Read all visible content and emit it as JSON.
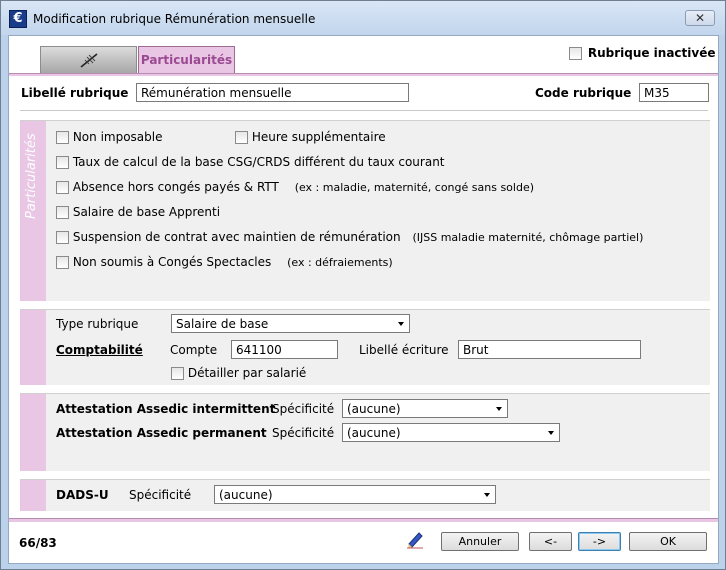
{
  "window": {
    "title": "Modification rubrique Rémunération mensuelle",
    "close_label": "✕"
  },
  "tabs": {
    "particularites_label": "Particularités"
  },
  "header": {
    "rubrique_inactivee_label": "Rubrique inactivée",
    "libelle_label": "Libellé rubrique",
    "libelle_value": "Rémunération mensuelle",
    "code_label": "Code rubrique",
    "code_value": "M35"
  },
  "particularites": {
    "section_label": "Particularités",
    "non_imposable": "Non imposable",
    "heure_sup": "Heure supplémentaire",
    "taux_csg": "Taux de calcul de la base CSG/CRDS différent du taux courant",
    "absence": "Absence hors congés payés & RTT",
    "absence_hint": "(ex : maladie, maternité, congé sans solde)",
    "apprenti": "Salaire de base Apprenti",
    "suspension": "Suspension de contrat avec maintien de rémunération",
    "suspension_hint": "(IJSS maladie maternité, chômage partiel)",
    "non_soumis": "Non soumis à Congés Spectacles",
    "non_soumis_hint": "(ex : défraiements)"
  },
  "type_section": {
    "type_label": "Type rubrique",
    "type_value": "Salaire de base",
    "comptabilite_label": "Comptabilité",
    "compte_label": "Compte",
    "compte_value": "641100",
    "libelle_ecriture_label": "Libellé écriture",
    "libelle_ecriture_value": "Brut",
    "detailler_label": "Détailler par salarié"
  },
  "assedic": {
    "intermittent_label": "Attestation Assedic intermittent",
    "permanent_label": "Attestation Assedic permanent",
    "specificite_label": "Spécificité",
    "intermittent_value": "(aucune)",
    "permanent_value": "(aucune)"
  },
  "dads": {
    "label": "DADS-U",
    "specificite_label": "Spécificité",
    "value": "(aucune)"
  },
  "footer": {
    "counter": "66/83",
    "annuler_label": "Annuler",
    "prev_label": "<-",
    "next_label": "->",
    "ok_label": "OK"
  }
}
